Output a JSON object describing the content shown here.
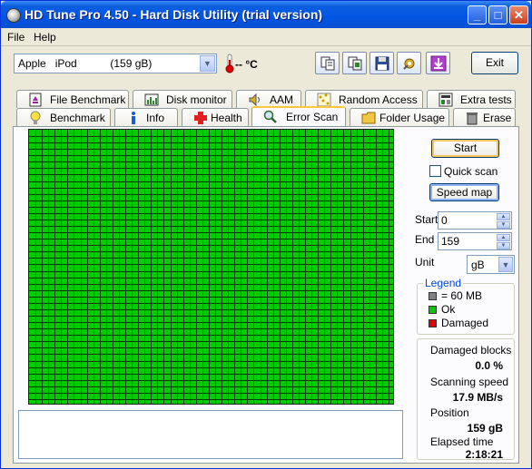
{
  "window": {
    "title": "HD Tune Pro 4.50 - Hard Disk Utility (trial version)",
    "minimize": "_",
    "maximize": "□",
    "close": "✕"
  },
  "menu": [
    "File",
    "Help"
  ],
  "toolbar": {
    "drive": "Apple   iPod           (159 gB)",
    "temperature": "-- °C",
    "exit_label": "Exit"
  },
  "tabs": {
    "row1": [
      {
        "label": "File Benchmark",
        "icon": "file-benchmark-icon"
      },
      {
        "label": "Disk monitor",
        "icon": "disk-monitor-icon"
      },
      {
        "label": "AAM",
        "icon": "speaker-icon"
      },
      {
        "label": "Random Access",
        "icon": "random-access-icon"
      },
      {
        "label": "Extra tests",
        "icon": "extra-tests-icon"
      }
    ],
    "row2": [
      {
        "label": "Benchmark",
        "icon": "lightbulb-icon"
      },
      {
        "label": "Info",
        "icon": "info-icon"
      },
      {
        "label": "Health",
        "icon": "health-cross-icon"
      },
      {
        "label": "Error Scan",
        "icon": "magnifier-icon",
        "active": true
      },
      {
        "label": "Folder Usage",
        "icon": "folder-icon"
      },
      {
        "label": "Erase",
        "icon": "trash-icon"
      }
    ]
  },
  "controls": {
    "start_button": "Start",
    "quick_scan_label": "Quick scan",
    "quick_scan_checked": false,
    "speed_map_button": "Speed map",
    "start_label": "Start",
    "start_value": "0",
    "end_label": "End",
    "end_value": "159",
    "unit_label": "Unit",
    "unit_value": "gB"
  },
  "legend": {
    "title": "Legend",
    "items": [
      {
        "label": "= 60 MB",
        "color": "#808080"
      },
      {
        "label": "Ok",
        "color": "#00CC00"
      },
      {
        "label": "Damaged",
        "color": "#E00000"
      }
    ]
  },
  "stats": {
    "damaged_blocks_label": "Damaged blocks",
    "damaged_blocks_value": "0.0 %",
    "scanning_speed_label": "Scanning speed",
    "scanning_speed_value": "17.9 MB/s",
    "position_label": "Position",
    "position_value": "159 gB",
    "elapsed_label": "Elapsed time",
    "elapsed_value": "2:18:21"
  },
  "scan_grid": {
    "block_color": "#00CC00",
    "columns": 57,
    "rows": 43,
    "all_blocks_ok": true
  }
}
